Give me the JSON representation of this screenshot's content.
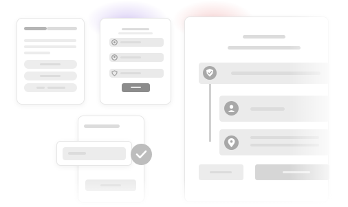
{
  "illustration": {
    "cards": [
      {
        "name": "left-card"
      },
      {
        "name": "middle-card"
      },
      {
        "name": "checked-card"
      },
      {
        "name": "main-card"
      }
    ],
    "icons": [
      "settings-icon",
      "user-icon",
      "shield-icon",
      "shield-check-icon",
      "user-icon",
      "location-pin-icon",
      "check-icon"
    ],
    "colors": {
      "glow_purple": "#a082e6",
      "glow_red": "#eb8c8c",
      "check_circle": "#bdbdbd",
      "placeholder": "#dcdcdc",
      "button_dark": "#8c8c8c"
    }
  }
}
